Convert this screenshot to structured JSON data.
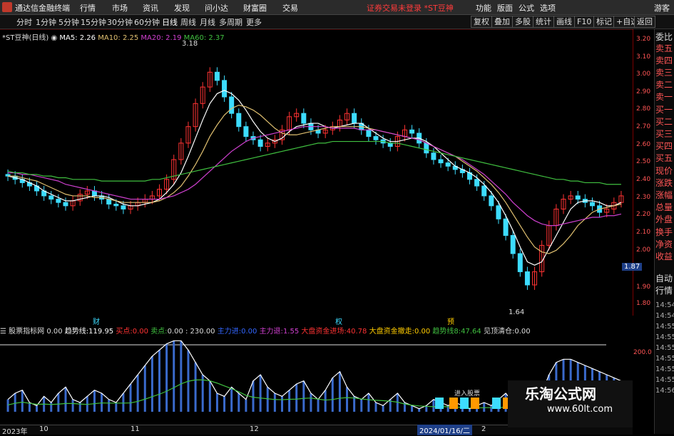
{
  "app": {
    "title": "通达信金融终端"
  },
  "menu": [
    "行情",
    "市场",
    "资讯",
    "发现",
    "问小达",
    "财富圈",
    "交易"
  ],
  "login_warning": "证券交易未登录 *ST豆神",
  "sys_menu": [
    "功能",
    "版面",
    "公式",
    "选项"
  ],
  "guest": "游客",
  "timeframes": [
    "分时",
    "1分钟",
    "5分钟",
    "15分钟",
    "30分钟",
    "60分钟",
    "日线",
    "周线",
    "月线",
    "多周期",
    "更多"
  ],
  "toolbar_right": [
    "复权",
    "叠加",
    "多股",
    "统计",
    "画线",
    "F10",
    "标记",
    "+自选",
    "返回"
  ],
  "chart_legend": {
    "name": "*ST豆神(日线)",
    "ma5": "MA5: 2.26",
    "ma10": "MA10: 2.25",
    "ma20": "MA20: 2.19",
    "ma60": "MA60: 2.37"
  },
  "price_axis": [
    "3.20",
    "3.10",
    "3.00",
    "2.90",
    "2.80",
    "2.70",
    "2.60",
    "2.50",
    "2.40",
    "2.30",
    "2.20",
    "2.10",
    "2.00",
    "1.90",
    "1.80"
  ],
  "current_price_tag": "1.87",
  "annotations": {
    "high": "3.18",
    "low": "1.64"
  },
  "event_labels": [
    "财",
    "权",
    "预"
  ],
  "side_panel": [
    "委比",
    "卖五",
    "卖四",
    "卖三",
    "卖二",
    "卖一",
    "买一",
    "买二",
    "买三",
    "买四",
    "买五",
    "现价",
    "涨跌",
    "涨幅",
    "总量",
    "外盘",
    "换手",
    "净资",
    "收益",
    "自动",
    "行情"
  ],
  "side_times": [
    "14:54",
    "14:54",
    "14:55",
    "14:55",
    "14:55",
    "14:55",
    "14:55",
    "14:55",
    "14:56"
  ],
  "indicator_bar": {
    "name": "股票指标网",
    "v0": "0.00",
    "trend_label": "趋势线:",
    "trend_val": "119.95",
    "buy_label": "买点:",
    "buy_val": "0.00",
    "sell_label": "卖点:",
    "sell_val": "0.00 : 230.00",
    "main_in_label": "主力进:",
    "main_in_val": "0.00",
    "main_out_label": "主力退:",
    "main_out_val": "1.55",
    "big_in_label": "大盘资金进场:",
    "big_in_val": "40.78",
    "big_out_label": "大盘资金撤走:",
    "big_out_val": "0.00",
    "trend8_label": "趋势线8:",
    "trend8_val": "47.64",
    "clear_label": "见顶清仓:",
    "clear_val": "0.00"
  },
  "sub_axis": "200.0",
  "sub_legend": "进入股票",
  "dates": [
    "2023年",
    "10",
    "11",
    "12",
    "2024/01/16/二",
    "2"
  ],
  "watermark": {
    "title": "乐淘公式网",
    "url": "www.60lt.com"
  },
  "colors": {
    "up": "#ff3333",
    "down": "#3ddcff",
    "ma5": "#ffffff",
    "ma10": "#e0c070",
    "ma20": "#d040d0",
    "ma60": "#40c040",
    "axis": "#7a0000"
  },
  "chart_data": {
    "type": "candlestick",
    "closes": [
      2.42,
      2.4,
      2.38,
      2.36,
      2.33,
      2.3,
      2.28,
      2.26,
      2.24,
      2.27,
      2.31,
      2.33,
      2.3,
      2.28,
      2.25,
      2.24,
      2.22,
      2.24,
      2.26,
      2.28,
      2.3,
      2.34,
      2.4,
      2.52,
      2.62,
      2.72,
      2.86,
      2.96,
      3.05,
      3.0,
      2.9,
      2.8,
      2.72,
      2.66,
      2.64,
      2.6,
      2.62,
      2.64,
      2.7,
      2.78,
      2.8,
      2.74,
      2.7,
      2.68,
      2.7,
      2.72,
      2.76,
      2.8,
      2.74,
      2.7,
      2.66,
      2.64,
      2.62,
      2.6,
      2.66,
      2.7,
      2.68,
      2.62,
      2.56,
      2.52,
      2.5,
      2.48,
      2.46,
      2.44,
      2.4,
      2.36,
      2.3,
      2.24,
      2.16,
      2.06,
      1.95,
      1.84,
      1.76,
      1.84,
      2.0,
      2.12,
      2.22,
      2.28,
      2.3,
      2.28,
      2.26,
      2.24,
      2.2,
      2.22,
      2.26,
      2.3
    ],
    "ma5": [
      2.42,
      2.41,
      2.4,
      2.38,
      2.36,
      2.33,
      2.31,
      2.29,
      2.27,
      2.27,
      2.28,
      2.29,
      2.3,
      2.3,
      2.29,
      2.27,
      2.25,
      2.24,
      2.24,
      2.25,
      2.26,
      2.28,
      2.32,
      2.37,
      2.44,
      2.54,
      2.65,
      2.76,
      2.86,
      2.92,
      2.94,
      2.92,
      2.88,
      2.82,
      2.75,
      2.69,
      2.65,
      2.63,
      2.65,
      2.69,
      2.72,
      2.73,
      2.74,
      2.74,
      2.72,
      2.71,
      2.72,
      2.73,
      2.74,
      2.74,
      2.71,
      2.68,
      2.65,
      2.63,
      2.63,
      2.64,
      2.65,
      2.65,
      2.63,
      2.6,
      2.56,
      2.52,
      2.48,
      2.46,
      2.44,
      2.41,
      2.37,
      2.32,
      2.26,
      2.18,
      2.09,
      1.99,
      1.9,
      1.88,
      1.9,
      1.98,
      2.06,
      2.14,
      2.22,
      2.26,
      2.27,
      2.27,
      2.26,
      2.24,
      2.24,
      2.26
    ],
    "ma10": [
      2.42,
      2.42,
      2.41,
      2.4,
      2.39,
      2.37,
      2.35,
      2.33,
      2.31,
      2.3,
      2.3,
      2.3,
      2.29,
      2.29,
      2.28,
      2.27,
      2.26,
      2.26,
      2.26,
      2.26,
      2.26,
      2.27,
      2.29,
      2.32,
      2.36,
      2.42,
      2.49,
      2.57,
      2.66,
      2.73,
      2.79,
      2.83,
      2.85,
      2.84,
      2.82,
      2.79,
      2.75,
      2.71,
      2.68,
      2.67,
      2.67,
      2.68,
      2.69,
      2.7,
      2.71,
      2.72,
      2.72,
      2.72,
      2.72,
      2.72,
      2.71,
      2.7,
      2.69,
      2.68,
      2.67,
      2.66,
      2.65,
      2.64,
      2.62,
      2.6,
      2.58,
      2.56,
      2.54,
      2.51,
      2.48,
      2.45,
      2.41,
      2.37,
      2.32,
      2.26,
      2.19,
      2.12,
      2.05,
      1.99,
      1.96,
      1.95,
      1.97,
      2.01,
      2.06,
      2.12,
      2.16,
      2.2,
      2.22,
      2.23,
      2.24,
      2.25
    ],
    "ma20": [
      2.44,
      2.44,
      2.43,
      2.43,
      2.42,
      2.41,
      2.4,
      2.39,
      2.37,
      2.36,
      2.35,
      2.34,
      2.33,
      2.32,
      2.31,
      2.3,
      2.29,
      2.28,
      2.28,
      2.28,
      2.28,
      2.28,
      2.29,
      2.3,
      2.32,
      2.34,
      2.37,
      2.41,
      2.45,
      2.49,
      2.53,
      2.57,
      2.6,
      2.63,
      2.65,
      2.66,
      2.67,
      2.68,
      2.69,
      2.7,
      2.71,
      2.72,
      2.72,
      2.72,
      2.72,
      2.71,
      2.71,
      2.71,
      2.71,
      2.7,
      2.7,
      2.7,
      2.69,
      2.68,
      2.67,
      2.66,
      2.65,
      2.64,
      2.62,
      2.6,
      2.58,
      2.56,
      2.54,
      2.52,
      2.49,
      2.46,
      2.43,
      2.39,
      2.35,
      2.31,
      2.26,
      2.22,
      2.18,
      2.15,
      2.13,
      2.12,
      2.12,
      2.13,
      2.14,
      2.15,
      2.16,
      2.17,
      2.17,
      2.18,
      2.18,
      2.19
    ],
    "ma60": [
      2.45,
      2.44,
      2.44,
      2.43,
      2.43,
      2.42,
      2.42,
      2.41,
      2.41,
      2.4,
      2.4,
      2.4,
      2.4,
      2.39,
      2.39,
      2.39,
      2.39,
      2.39,
      2.39,
      2.39,
      2.4,
      2.4,
      2.41,
      2.42,
      2.43,
      2.44,
      2.45,
      2.46,
      2.47,
      2.48,
      2.49,
      2.5,
      2.51,
      2.52,
      2.53,
      2.54,
      2.55,
      2.56,
      2.57,
      2.58,
      2.59,
      2.6,
      2.61,
      2.62,
      2.62,
      2.63,
      2.63,
      2.63,
      2.63,
      2.63,
      2.63,
      2.63,
      2.63,
      2.62,
      2.62,
      2.61,
      2.6,
      2.59,
      2.58,
      2.57,
      2.56,
      2.55,
      2.54,
      2.53,
      2.52,
      2.51,
      2.5,
      2.49,
      2.48,
      2.47,
      2.46,
      2.45,
      2.44,
      2.43,
      2.42,
      2.41,
      2.4,
      2.4,
      2.39,
      2.39,
      2.38,
      2.38,
      2.38,
      2.37,
      2.37,
      2.37
    ],
    "yrange": [
      1.6,
      3.25
    ],
    "sub_trend": [
      40,
      60,
      70,
      30,
      20,
      50,
      30,
      60,
      80,
      40,
      30,
      50,
      70,
      60,
      40,
      30,
      60,
      90,
      120,
      150,
      180,
      200,
      220,
      230,
      230,
      200,
      160,
      120,
      100,
      60,
      50,
      80,
      60,
      40,
      100,
      120,
      80,
      60,
      50,
      70,
      90,
      100,
      60,
      40,
      70,
      110,
      130,
      80,
      50,
      40,
      60,
      30,
      20,
      40,
      60,
      30,
      20,
      10,
      20,
      40,
      30,
      20,
      30,
      20,
      10,
      20,
      30,
      20,
      40,
      60,
      30,
      20,
      10,
      30,
      60,
      120,
      160,
      170,
      170,
      160,
      150,
      140,
      130,
      120,
      110,
      100
    ]
  }
}
